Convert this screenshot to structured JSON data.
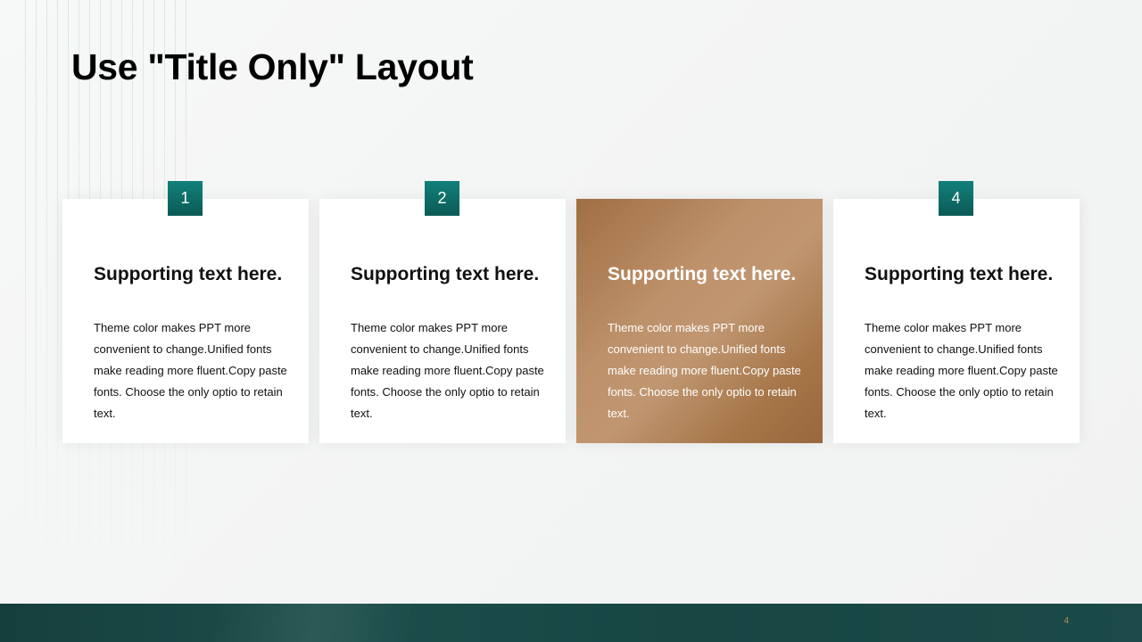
{
  "slide": {
    "title": "Use \"Title Only\" Layout",
    "page_number": "4"
  },
  "cards": [
    {
      "number": "1",
      "heading": "Supporting text here.",
      "body": "Theme color makes PPT more convenient to change.Unified fonts make reading more fluent.Copy paste fonts. Choose the only optio to retain text."
    },
    {
      "number": "2",
      "heading": "Supporting text here.",
      "body": "Theme color makes PPT more convenient to change.Unified fonts make reading more fluent.Copy paste fonts. Choose the only optio to retain text."
    },
    {
      "number": "",
      "heading": "Supporting text here.",
      "body": "Theme color makes PPT more convenient to change.Unified fonts make reading more fluent.Copy paste fonts. Choose the only optio to retain text.",
      "highlighted": true
    },
    {
      "number": "4",
      "heading": "Supporting text here.",
      "body": "Theme color makes PPT more convenient to change.Unified fonts make reading more fluent.Copy paste fonts. Choose the only optio to retain text."
    }
  ],
  "colors": {
    "badge": "#0e6f6a",
    "highlight_card": "#b28458",
    "footer": "#1a4745",
    "page_number": "#b98b5c"
  }
}
